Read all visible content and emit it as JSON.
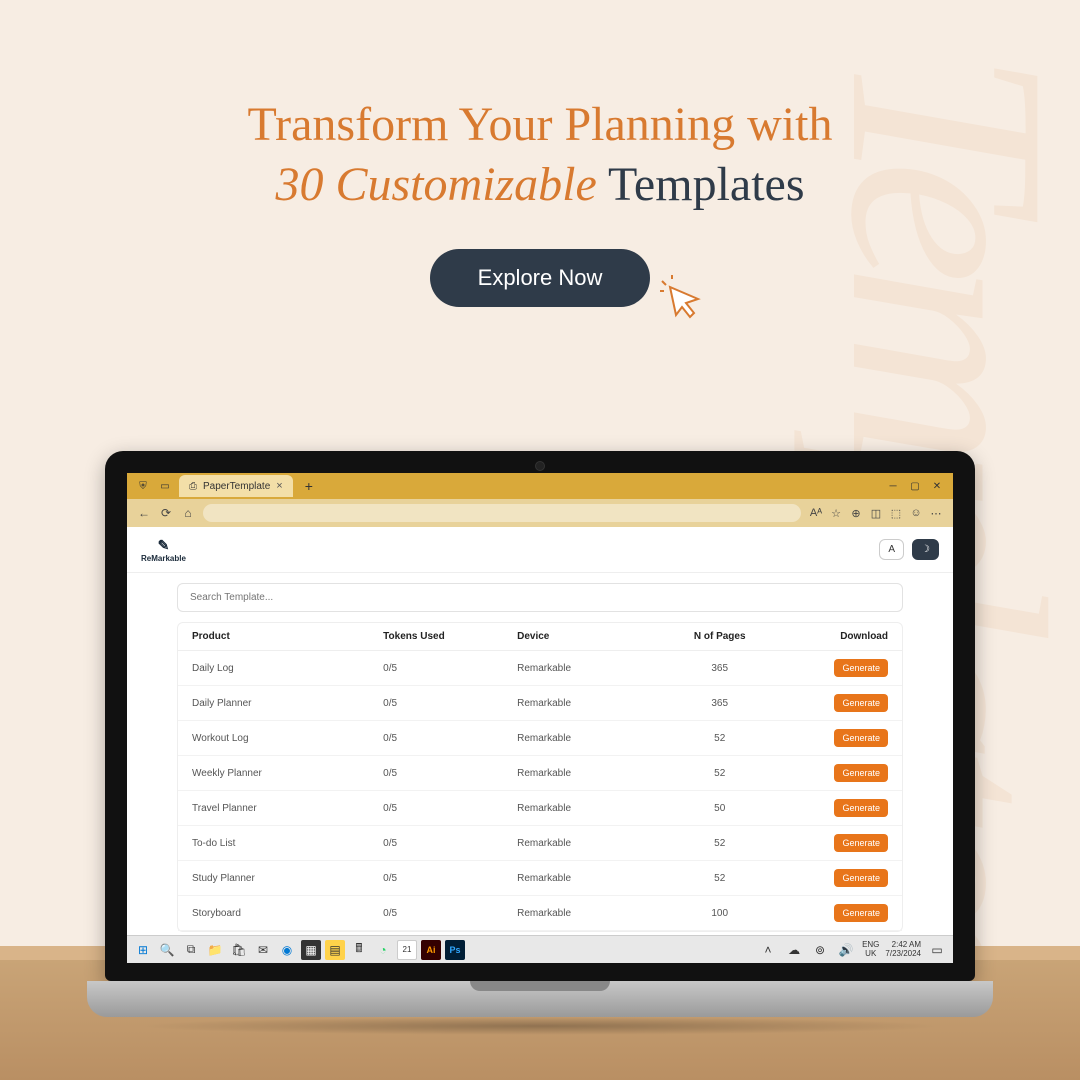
{
  "bg_word": "Templates",
  "headline": {
    "line1": "Transform Your Planning with",
    "line2_italic": "30 Customizable",
    "line2_dark": "Templates"
  },
  "cta_label": "Explore Now",
  "browser": {
    "tab_title": "PaperTemplate",
    "toolbar": {
      "font_btn": "A"
    }
  },
  "site": {
    "logo_text": "ReMarkable"
  },
  "search": {
    "placeholder": "Search Template..."
  },
  "table": {
    "headers": {
      "product": "Product",
      "tokens": "Tokens Used",
      "device": "Device",
      "pages": "N of Pages",
      "download": "Download"
    },
    "generate_label": "Generate",
    "rows": [
      {
        "product": "Daily Log",
        "tokens": "0/5",
        "device": "Remarkable",
        "pages": "365"
      },
      {
        "product": "Daily Planner",
        "tokens": "0/5",
        "device": "Remarkable",
        "pages": "365"
      },
      {
        "product": "Workout Log",
        "tokens": "0/5",
        "device": "Remarkable",
        "pages": "52"
      },
      {
        "product": "Weekly Planner",
        "tokens": "0/5",
        "device": "Remarkable",
        "pages": "52"
      },
      {
        "product": "Travel Planner",
        "tokens": "0/5",
        "device": "Remarkable",
        "pages": "50"
      },
      {
        "product": "To-do List",
        "tokens": "0/5",
        "device": "Remarkable",
        "pages": "52"
      },
      {
        "product": "Study Planner",
        "tokens": "0/5",
        "device": "Remarkable",
        "pages": "52"
      },
      {
        "product": "Storyboard",
        "tokens": "0/5",
        "device": "Remarkable",
        "pages": "100"
      }
    ]
  },
  "taskbar": {
    "lang": "ENG",
    "region": "UK",
    "time": "2:42 AM",
    "date": "7/23/2024"
  }
}
